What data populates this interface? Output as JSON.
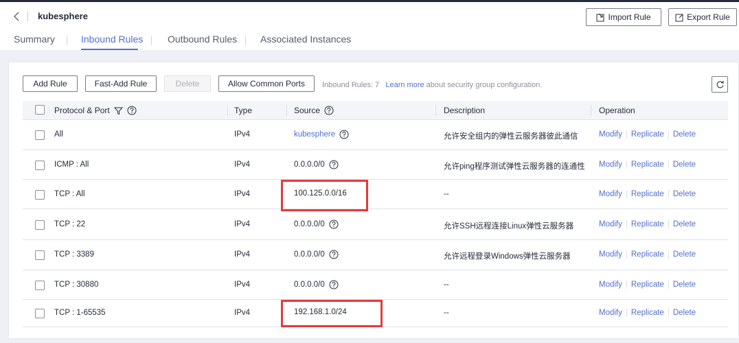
{
  "header": {
    "title": "kubesphere",
    "import_label": "Import Rule",
    "export_label": "Export Rule"
  },
  "tabs": [
    "Summary",
    "Inbound Rules",
    "Outbound Rules",
    "Associated Instances"
  ],
  "active_tab": "Inbound Rules",
  "toolbar": {
    "add_rule": "Add Rule",
    "fast_add_rule": "Fast-Add Rule",
    "delete": "Delete",
    "allow_common_ports": "Allow Common Ports",
    "info_prefix": "Inbound Rules: 7",
    "learn_more": "Learn more",
    "info_suffix": "about security group configuration."
  },
  "table": {
    "columns": [
      "Protocol & Port",
      "Type",
      "Source",
      "Description",
      "Operation"
    ],
    "operations": [
      "Modify",
      "Replicate",
      "Delete"
    ],
    "rows": [
      {
        "protocol": "All",
        "type": "IPv4",
        "source": "kubesphere",
        "description": "允许安全组内的弹性云服务器彼此通信"
      },
      {
        "protocol": "ICMP : All",
        "type": "IPv4",
        "source": "0.0.0.0/0",
        "description": "允许ping程序测试弹性云服务器的连通性"
      },
      {
        "protocol": "TCP : All",
        "type": "IPv4",
        "source": "100.125.0.0/16",
        "description": "--"
      },
      {
        "protocol": "TCP : 22",
        "type": "IPv4",
        "source": "0.0.0.0/0",
        "description": "允许SSH远程连接Linux弹性云服务器"
      },
      {
        "protocol": "TCP : 3389",
        "type": "IPv4",
        "source": "0.0.0.0/0",
        "description": "允许远程登录Windows弹性云服务器"
      },
      {
        "protocol": "TCP : 30880",
        "type": "IPv4",
        "source": "0.0.0.0/0",
        "description": "--"
      },
      {
        "protocol": "TCP : 1-65535",
        "type": "IPv4",
        "source": "192.168.1.0/24",
        "description": "--"
      }
    ]
  },
  "colors": {
    "accent": "#526ecc",
    "highlight": "#e5393b"
  }
}
